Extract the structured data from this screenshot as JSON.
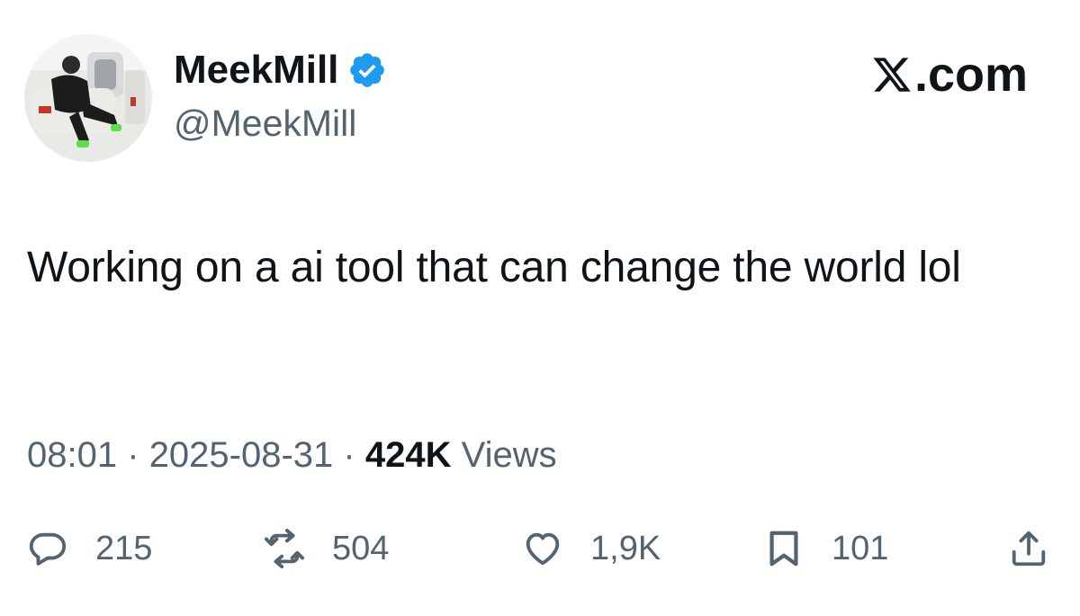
{
  "header": {
    "display_name": "MeekMill",
    "handle": "@MeekMill",
    "verified": true,
    "brand": ".com",
    "brand_icon": "x-logo-icon"
  },
  "tweet": {
    "text": "Working on a ai tool that can change the world lol"
  },
  "meta": {
    "time": "08:01",
    "separator": "·",
    "date": "2025-08-31",
    "views_count": "424K",
    "views_label": "Views"
  },
  "actions": {
    "replies": "215",
    "reposts": "504",
    "likes": "1,9K",
    "bookmarks": "101"
  },
  "colors": {
    "text": "#0f1419",
    "secondary": "#536471",
    "verified": "#1d9bf0"
  }
}
